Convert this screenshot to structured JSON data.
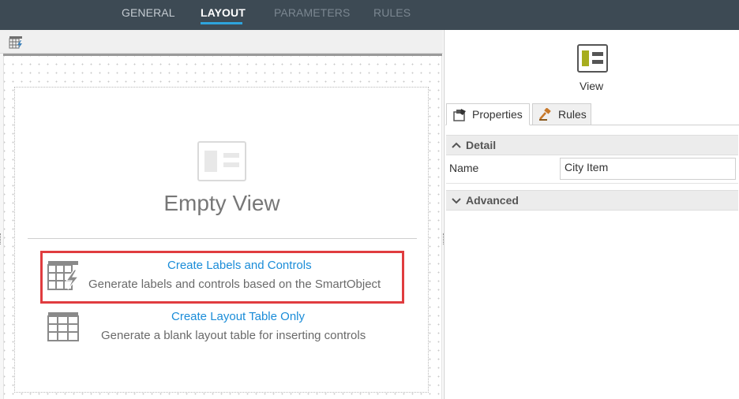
{
  "tabs": {
    "general": "GENERAL",
    "layout": "LAYOUT",
    "parameters": "PARAMETERS",
    "rules": "RULES",
    "active": "LAYOUT"
  },
  "canvas": {
    "empty_title": "Empty View",
    "options": [
      {
        "link": "Create Labels and Controls",
        "description": "Generate labels and controls based on the SmartObject",
        "icon": "table-lightning-icon",
        "highlighted": true
      },
      {
        "link": "Create Layout Table Only",
        "description": "Generate a blank layout table for inserting controls",
        "icon": "table-grid-icon",
        "highlighted": false
      }
    ]
  },
  "panel": {
    "view_label": "View",
    "tabs": [
      "Properties",
      "Rules"
    ],
    "sections": {
      "detail": "Detail",
      "advanced": "Advanced"
    },
    "fields": {
      "name_label": "Name",
      "name_value": "City Item"
    }
  },
  "colors": {
    "topbar": "#3d4a54",
    "accent": "#2ea4dd",
    "link": "#1a8cd8",
    "highlight": "#e03c3f",
    "view_icon_accent": "#a7ad1e"
  }
}
